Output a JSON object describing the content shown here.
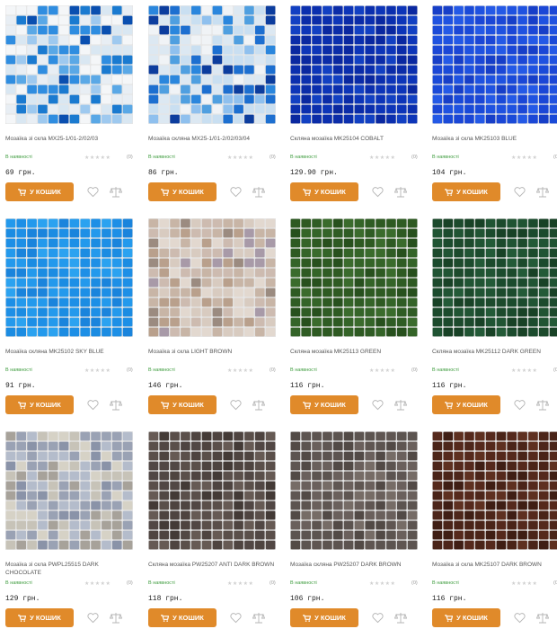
{
  "labels": {
    "in_stock": "В наявності",
    "cart_button": "У КОШИК",
    "rating_stars": "★★★★★",
    "reviews": "(0)"
  },
  "products": [
    {
      "name": "Мозаїка зі скла MX25-1/01-2/02/03",
      "price": "69 грн.",
      "mosaic": {
        "base": [
          "#f4f6f8",
          "#e8eef4",
          "#5aa8e6",
          "#1a7ad0",
          "#0a4fb0",
          "#9ec9ef",
          "#d9e7f2",
          "#2f8de0"
        ],
        "weights": [
          4,
          3,
          2,
          2,
          1,
          2,
          3,
          2
        ]
      }
    },
    {
      "name": "Мозаїка скляна MX25-1/01-2/02/03/04",
      "price": "86 грн.",
      "mosaic": {
        "base": [
          "#f0f3f6",
          "#dce8f2",
          "#4f9fe0",
          "#1d6fd0",
          "#0c3d9e",
          "#8fc0ee",
          "#c9dff1",
          "#2a86dd"
        ],
        "weights": [
          3,
          3,
          2,
          2,
          2,
          2,
          3,
          2
        ]
      }
    },
    {
      "name": "Скляна мозаїка MK25104 COBALT",
      "price": "129.90 грн.",
      "mosaic": {
        "base": [
          "#0b2fae",
          "#0d35b8",
          "#0a28a0",
          "#1240c2",
          "#0b2ca8"
        ],
        "weights": [
          3,
          3,
          2,
          2,
          2
        ]
      }
    },
    {
      "name": "Мозаїка зі скла MK25103 BLUE",
      "price": "104 грн.",
      "mosaic": {
        "base": [
          "#1b47d6",
          "#1f52e0",
          "#173fc8",
          "#2459e6",
          "#1a4ad8"
        ],
        "weights": [
          3,
          3,
          2,
          2,
          2
        ]
      }
    },
    {
      "name": "Мозаїка скляна MK25102 SKY BLUE",
      "price": "91 грн.",
      "mosaic": {
        "base": [
          "#1d8fe6",
          "#2399ec",
          "#1a84dc",
          "#2ba2f0",
          "#1b8ce2"
        ],
        "weights": [
          3,
          3,
          2,
          2,
          2
        ]
      }
    },
    {
      "name": "Мозаїка зі скла LIGHT BROWN",
      "price": "146 грн.",
      "mosaic": {
        "base": [
          "#d8cbc0",
          "#c8b5a6",
          "#b9a08c",
          "#e2d8cf",
          "#a89aa8",
          "#cdbbb0",
          "#9b8b80"
        ],
        "weights": [
          3,
          3,
          2,
          3,
          1,
          2,
          1
        ]
      }
    },
    {
      "name": "Скляна мозаїка MK25113 GREEN",
      "price": "116 грн.",
      "mosaic": {
        "base": [
          "#2e5a22",
          "#346428",
          "#27501d",
          "#3a6b2c",
          "#2f5c24"
        ],
        "weights": [
          3,
          3,
          2,
          2,
          2
        ]
      }
    },
    {
      "name": "Скляна мозаїка MK25112 DARK GREEN",
      "price": "116 грн.",
      "mosaic": {
        "base": [
          "#1c4a2c",
          "#205433",
          "#184226",
          "#235a37",
          "#1b4b2d"
        ],
        "weights": [
          3,
          3,
          2,
          2,
          2
        ]
      }
    },
    {
      "name": "Мозаїка зі скла PWPL25515 DARK CHOCOLATE",
      "price": "129 грн.",
      "mosaic": {
        "base": [
          "#9aa2b4",
          "#b4bccb",
          "#c7c3b8",
          "#8a93a8",
          "#d6d2c6",
          "#a7a29a"
        ],
        "weights": [
          3,
          3,
          2,
          2,
          2,
          2
        ]
      }
    },
    {
      "name": "Скляна мозаїка PW25207 ANTI DARK BROWN",
      "price": "118 грн.",
      "mosaic": {
        "base": [
          "#4e4440",
          "#5a4f4a",
          "#433a36",
          "#665a54",
          "#514744"
        ],
        "weights": [
          3,
          3,
          2,
          2,
          2
        ]
      }
    },
    {
      "name": "Мозаїка скляна PW25207 DARK BROWN",
      "price": "106 грн.",
      "mosaic": {
        "base": [
          "#5c5450",
          "#6a605c",
          "#524a46",
          "#766c66",
          "#5f5652"
        ],
        "weights": [
          3,
          3,
          2,
          2,
          2
        ]
      }
    },
    {
      "name": "Мозаїка зі скла MK25107 DARK BROWN",
      "price": "116 грн.",
      "mosaic": {
        "base": [
          "#4a2418",
          "#55291c",
          "#3f1e14",
          "#5e3020",
          "#4d261a"
        ],
        "weights": [
          3,
          3,
          2,
          2,
          2
        ]
      }
    }
  ],
  "colors": {
    "accent": "#e08a2a",
    "in_stock": "#3a9a3a"
  },
  "icons": {
    "cart": "cart-icon",
    "wishlist": "heart-icon",
    "compare": "scales-icon"
  }
}
